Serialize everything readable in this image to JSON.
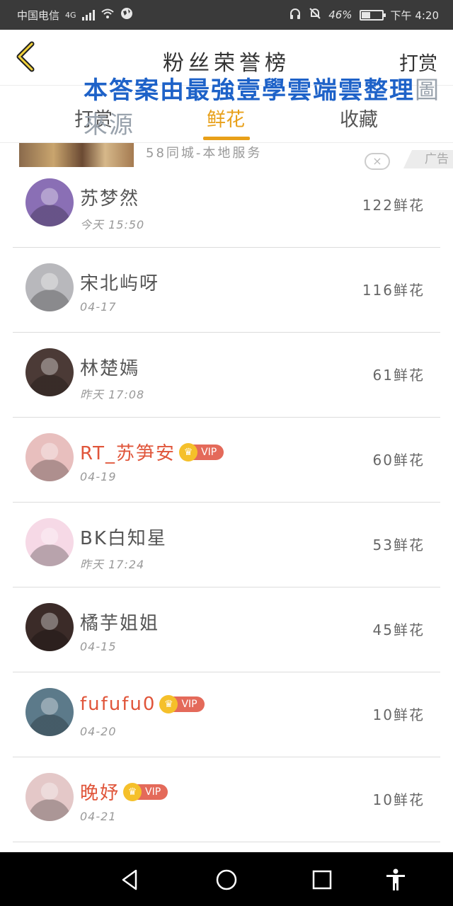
{
  "status_bar": {
    "carrier": "中国电信",
    "network": "4G",
    "battery": "46%",
    "battery_level": 0.46,
    "time": "下午 4:20"
  },
  "header": {
    "title": "粉丝荣誉榜",
    "reward_link": "打赏",
    "watermark": "本答案由最強壹學雲端雲整理",
    "watermark_tail": "圖來源"
  },
  "tabs": [
    {
      "label": "打赏",
      "active": false
    },
    {
      "label": "鲜花",
      "active": true
    },
    {
      "label": "收藏",
      "active": false
    }
  ],
  "ad": {
    "text": "58同城-本地服务",
    "close": "×",
    "badge": "广告"
  },
  "fans": [
    {
      "name": "苏梦然",
      "time": "今天 15:50",
      "flowers": "122鲜花",
      "vip": false,
      "avatar_color": "#8a6fb5"
    },
    {
      "name": "宋北屿呀",
      "time": "04-17",
      "flowers": "116鲜花",
      "vip": false,
      "avatar_color": "#b8b8bc"
    },
    {
      "name": "林楚嫣",
      "time": "昨天 17:08",
      "flowers": "61鲜花",
      "vip": false,
      "avatar_color": "#4b3a36"
    },
    {
      "name": "RT_苏笋安",
      "time": "04-19",
      "flowers": "60鲜花",
      "vip": true,
      "avatar_color": "#e8bfbe"
    },
    {
      "name": "BK白知星",
      "time": "昨天 17:24",
      "flowers": "53鲜花",
      "vip": false,
      "avatar_color": "#f6d9e6"
    },
    {
      "name": "橘芋姐姐",
      "time": "04-15",
      "flowers": "45鲜花",
      "vip": false,
      "avatar_color": "#3b2b28"
    },
    {
      "name": "fufufu0",
      "time": "04-20",
      "flowers": "10鲜花",
      "vip": true,
      "avatar_color": "#5c7a8a"
    },
    {
      "name": "晚妤",
      "time": "04-21",
      "flowers": "10鲜花",
      "vip": true,
      "avatar_color": "#e4c8c8"
    }
  ],
  "vip_label": "VIP",
  "colors": {
    "accent": "#e8a019",
    "vip_name": "#e0553a",
    "vip_badge": "#e46a5a",
    "watermark": "#1e62c8"
  },
  "icons": {
    "back": "back-arrow-icon",
    "nav_back": "nav-back-icon",
    "nav_home": "nav-home-icon",
    "nav_recent": "nav-recent-icon",
    "accessibility": "accessibility-icon"
  }
}
